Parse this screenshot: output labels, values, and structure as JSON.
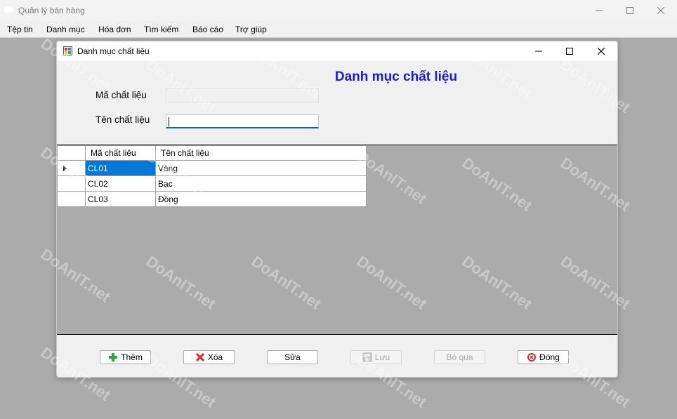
{
  "app": {
    "title": "Quản lý bán hàng",
    "menu": [
      "Tệp tin",
      "Danh mục",
      "Hóa đơn",
      "Tìm kiếm",
      "Báo cáo",
      "Trợ giúp"
    ]
  },
  "dialog": {
    "title": "Danh mục chất liệu",
    "heading": "Danh mục chất liệu",
    "fields": {
      "code_label": "Mã chất liệu",
      "code_value": "",
      "name_label": "Tên chất liệu",
      "name_value": ""
    },
    "grid": {
      "columns": [
        "Mã chất liệu",
        "Tên chất liệu"
      ],
      "rows": [
        {
          "code": "CL01",
          "name": "Vàng"
        },
        {
          "code": "CL02",
          "name": "Bạc"
        },
        {
          "code": "CL03",
          "name": "Đồng"
        }
      ]
    },
    "buttons": {
      "add": "Thêm",
      "delete": "Xóa",
      "edit": "Sửa",
      "save": "Lưu",
      "skip": "Bỏ qua",
      "close": "Đóng"
    }
  },
  "watermark": "DoAnIT.net",
  "colors": {
    "heading": "#1a1adf",
    "selection": "#0078d7",
    "mdi_background": "#ababab"
  }
}
